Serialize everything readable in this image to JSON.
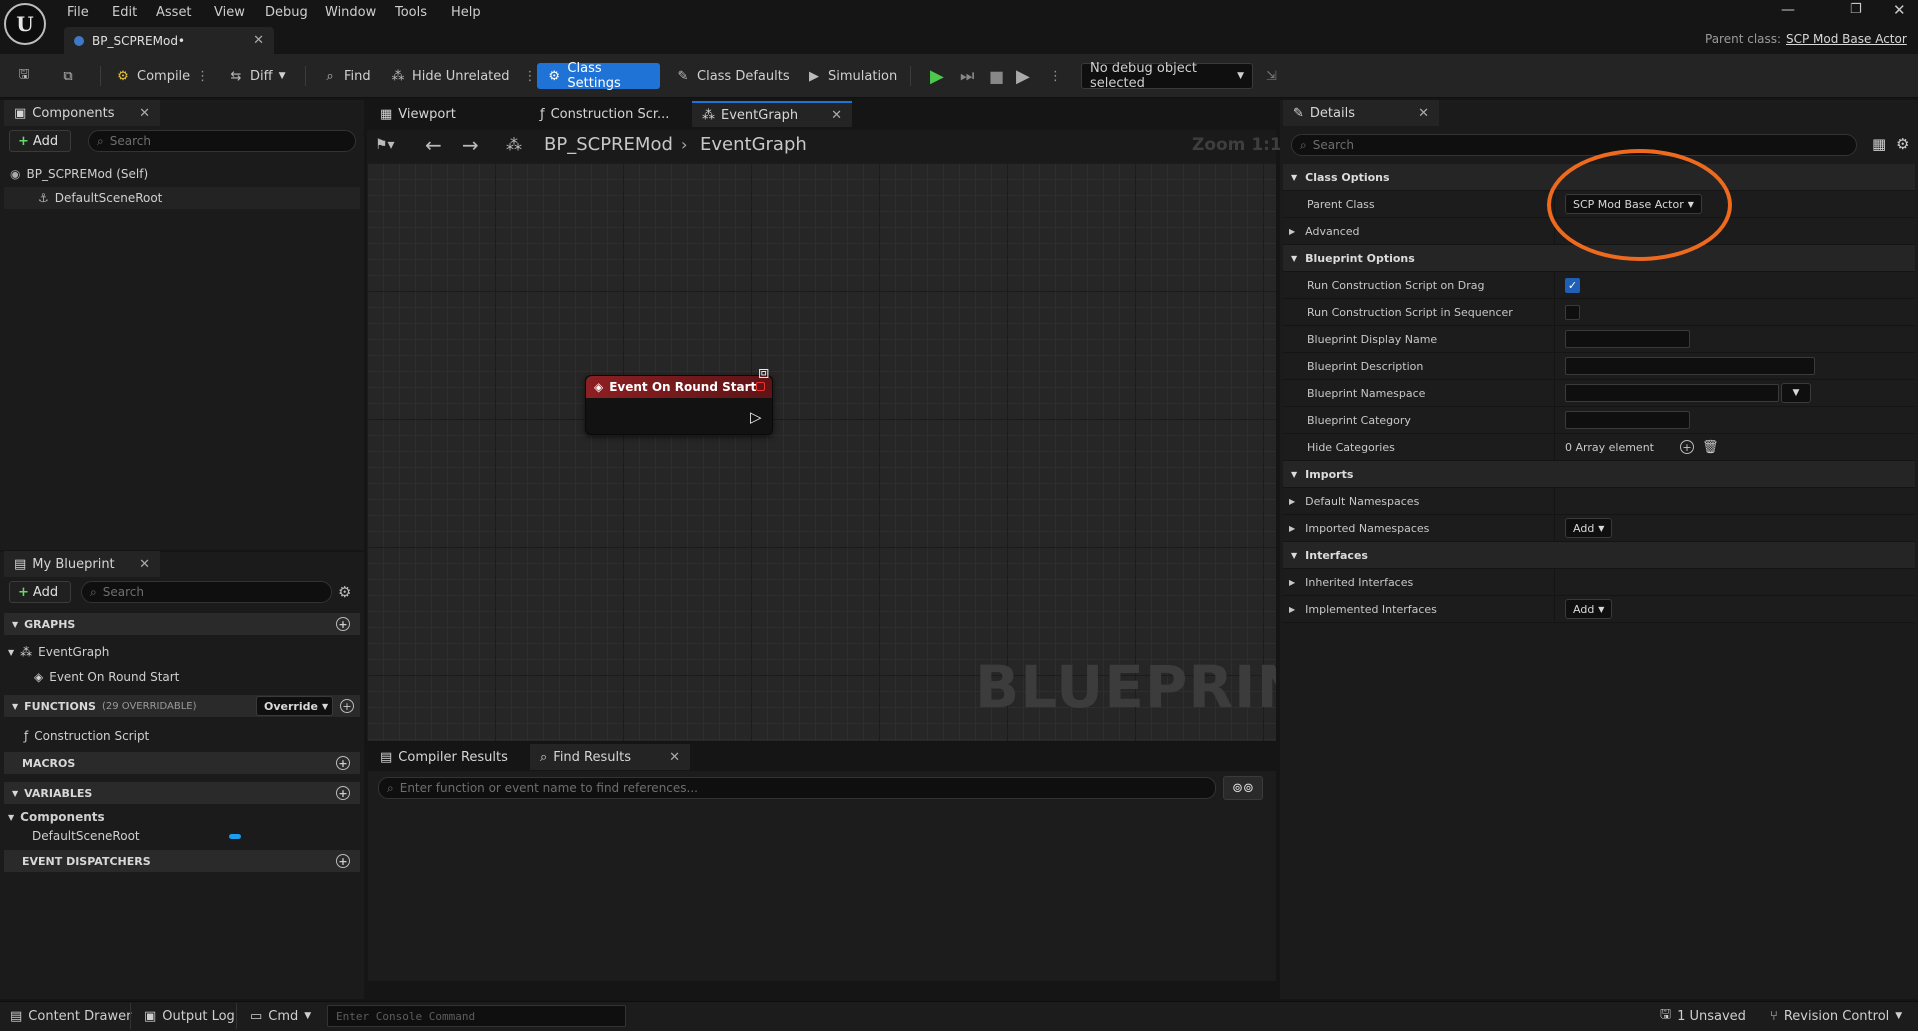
{
  "app": {
    "logo": "U"
  },
  "menu": {
    "items": [
      "File",
      "Edit",
      "Asset",
      "View",
      "Debug",
      "Window",
      "Tools",
      "Help"
    ]
  },
  "document_tab": {
    "label": "BP_SCPREMod•"
  },
  "parent_class": {
    "label": "Parent class:",
    "value": "SCP Mod Base Actor"
  },
  "toolbar": {
    "compile": "Compile",
    "diff": "Diff",
    "find": "Find",
    "hide_unrelated": "Hide Unrelated",
    "class_settings": "Class Settings",
    "class_defaults": "Class Defaults",
    "simulation": "Simulation",
    "debug_object": "No debug object selected"
  },
  "components_panel": {
    "tab": "Components",
    "add": "Add",
    "search_placeholder": "Search",
    "tree": [
      "BP_SCPREMod (Self)",
      "DefaultSceneRoot"
    ]
  },
  "my_blueprint": {
    "tab": "My Blueprint",
    "add": "Add",
    "search_placeholder": "Search",
    "graphs_header": "GRAPHS",
    "graph_items": [
      "EventGraph",
      "Event On Round Start"
    ],
    "functions_header": "FUNCTIONS",
    "functions_count": "(29 OVERRIDABLE)",
    "override": "Override",
    "function_items": [
      "Construction Script"
    ],
    "macros_header": "MACROS",
    "variables_header": "VARIABLES",
    "variables_category": "Components",
    "variable_items": [
      "DefaultSceneRoot"
    ],
    "dispatchers_header": "EVENT DISPATCHERS"
  },
  "editor_tabs": [
    "Viewport",
    "Construction Scr...",
    "EventGraph"
  ],
  "breadcrumb": {
    "blueprint": "BP_SCPREMod",
    "graph": "EventGraph"
  },
  "zoom": "Zoom 1:1",
  "node": {
    "title": "Event On Round Start"
  },
  "watermark": "BLUEPRINT",
  "bottom_panel": {
    "tabs": [
      "Compiler Results",
      "Find Results"
    ],
    "find_placeholder": "Enter function or event name to find references..."
  },
  "details": {
    "tab": "Details",
    "search_placeholder": "Search",
    "sections": {
      "class_options": "Class Options",
      "blueprint_options": "Blueprint Options",
      "imports": "Imports",
      "interfaces": "Interfaces"
    },
    "parent_class_label": "Parent Class",
    "parent_class_value": "SCP Mod Base Actor",
    "advanced": "Advanced",
    "run_construction_drag": "Run Construction Script on Drag",
    "run_construction_drag_checked": true,
    "run_construction_seq": "Run Construction Script in Sequencer",
    "run_construction_seq_checked": false,
    "display_name": "Blueprint Display Name",
    "description": "Blueprint Description",
    "namespace": "Blueprint Namespace",
    "category": "Blueprint Category",
    "hide_categories": "Hide Categories",
    "array_elements": "0 Array element",
    "default_namespaces": "Default Namespaces",
    "imported_namespaces": "Imported Namespaces",
    "add": "Add",
    "inherited_interfaces": "Inherited Interfaces",
    "implemented_interfaces": "Implemented Interfaces"
  },
  "statusbar": {
    "content_drawer": "Content Drawer",
    "output_log": "Output Log",
    "cmd": "Cmd",
    "console_placeholder": "Enter Console Command",
    "unsaved": "1 Unsaved",
    "revision_control": "Revision Control"
  },
  "colors": {
    "accent": "#1f73d6",
    "highlight_circle": "#ee6a1f",
    "event_node": "#8c1f22",
    "variable_pill": "#1b9df0"
  }
}
